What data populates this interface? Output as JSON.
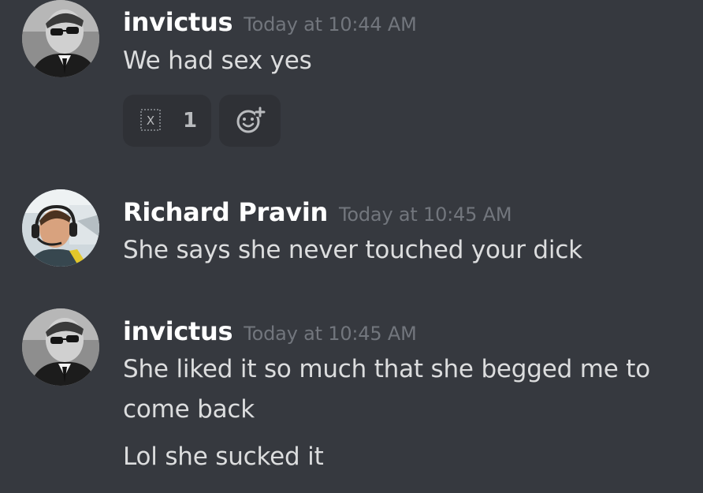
{
  "messages": [
    {
      "username": "invictus",
      "timestamp": "Today at 10:44 AM",
      "avatar": "man-with-sunglasses-avatar",
      "lines": [
        "We had sex yes"
      ],
      "reactions": [
        {
          "emoji": "unknown-emoji-box-icon",
          "glyph": "X",
          "count": "1"
        }
      ],
      "add_reaction_icon": "add-reaction-icon"
    },
    {
      "username": "Richard Pravin",
      "timestamp": "Today at 10:45 AM",
      "avatar": "man-with-headset-avatar",
      "lines": [
        "She says she never touched your dick"
      ]
    },
    {
      "username": "invictus",
      "timestamp": "Today at 10:45 AM",
      "avatar": "man-with-sunglasses-avatar",
      "lines": [
        "She liked it so much that she begged me to",
        "come back",
        "Lol she sucked it"
      ]
    }
  ],
  "colors": {
    "background": "#36393f",
    "username": "#ffffff",
    "timestamp": "#72767d",
    "text": "#dcddde",
    "reaction_bg": "#2f3136"
  }
}
